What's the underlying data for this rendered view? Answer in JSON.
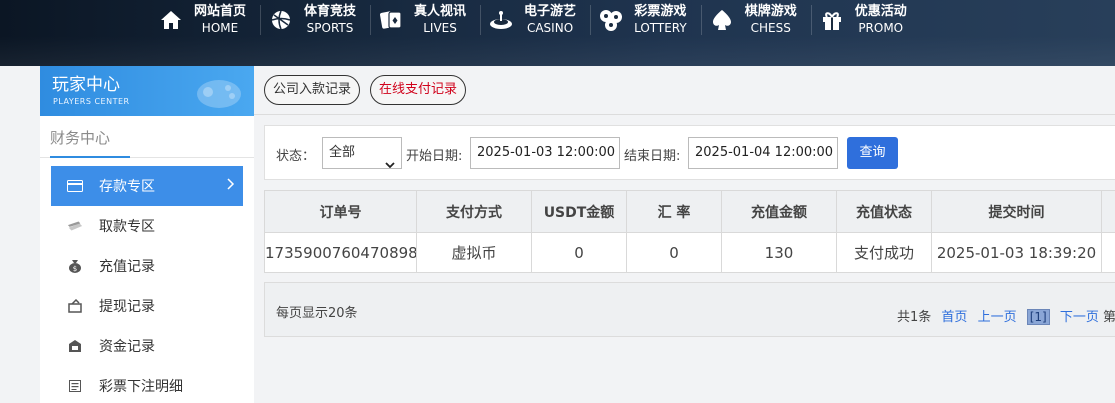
{
  "nav": [
    {
      "cn": "网站首页",
      "en": "HOME",
      "icon": "home-icon"
    },
    {
      "cn": "体育竞技",
      "en": "SPORTS",
      "icon": "sports-ball-icon"
    },
    {
      "cn": "真人视讯",
      "en": "LIVES",
      "icon": "playing-cards-icon"
    },
    {
      "cn": "电子游艺",
      "en": "CASINO",
      "icon": "roulette-icon"
    },
    {
      "cn": "彩票游戏",
      "en": "LOTTERY",
      "icon": "lottery-balls-icon"
    },
    {
      "cn": "棋牌游戏",
      "en": "CHESS",
      "icon": "spade-icon"
    },
    {
      "cn": "优惠活动",
      "en": "PROMO",
      "icon": "gift-icon"
    }
  ],
  "sidebar": {
    "title": "玩家中心",
    "subtitle": "PLAYERS CENTER",
    "section": "财务中心",
    "items": [
      {
        "label": "存款专区",
        "icon": "card-icon"
      },
      {
        "label": "取款专区",
        "icon": "cash-icon"
      },
      {
        "label": "充值记录",
        "icon": "money-bag-icon"
      },
      {
        "label": "提现记录",
        "icon": "withdraw-icon"
      },
      {
        "label": "资金记录",
        "icon": "wallet-icon"
      },
      {
        "label": "彩票下注明细",
        "icon": "list-icon"
      }
    ]
  },
  "tabs": {
    "company": "公司入款记录",
    "online": "在线支付记录"
  },
  "filter": {
    "status_label": "状态：",
    "status_value": "全部",
    "start_label": "开始日期:",
    "start_value": "2025-01-03 12:00:00",
    "end_label": "结束日期:",
    "end_value": "2025-01-04 12:00:00",
    "query": "查询"
  },
  "table": {
    "headers": [
      "订单号",
      "支付方式",
      "USDT金额",
      "汇 率",
      "充值金额",
      "充值状态",
      "提交时间"
    ],
    "rows": [
      [
        "1735900760470898",
        "虚拟币",
        "0",
        "0",
        "130",
        "支付成功",
        "2025-01-03 18:39:20"
      ]
    ]
  },
  "footer": {
    "per_page": "每页显示20条",
    "total": "共1条",
    "first": "首页",
    "prev": "上一页",
    "current": "[1]",
    "next": "下一页",
    "last_partial": "第"
  },
  "colors": {
    "accent": "#3d8ee8",
    "query_button": "#2f6fdc",
    "tab_red": "#d0021b"
  }
}
